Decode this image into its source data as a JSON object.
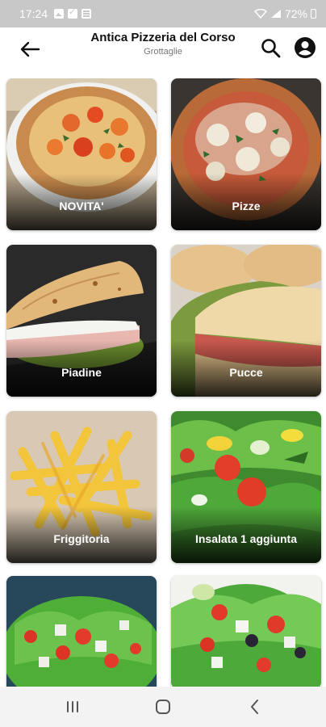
{
  "status_bar": {
    "time": "17:24",
    "battery": "72%"
  },
  "header": {
    "title": "Antica Pizzeria del Corso",
    "subtitle": "Grottaglie"
  },
  "categories": [
    {
      "label": "NOVITA'"
    },
    {
      "label": "Pizze"
    },
    {
      "label": "Piadine"
    },
    {
      "label": "Pucce"
    },
    {
      "label": "Friggitoria"
    },
    {
      "label": "Insalata 1 aggiunta"
    },
    {
      "label": ""
    },
    {
      "label": ""
    }
  ],
  "icons": {
    "back": "arrow-left-icon",
    "search": "search-icon",
    "account": "account-icon",
    "nav_recent": "recent-apps-icon",
    "nav_home": "home-icon",
    "nav_back": "back-icon"
  },
  "colors": {
    "status_bar_bg": "#c8c8c8",
    "header_bg": "#ffffff",
    "label_text": "#ffffff",
    "nav_bar_bg": "#f3f3f3"
  }
}
